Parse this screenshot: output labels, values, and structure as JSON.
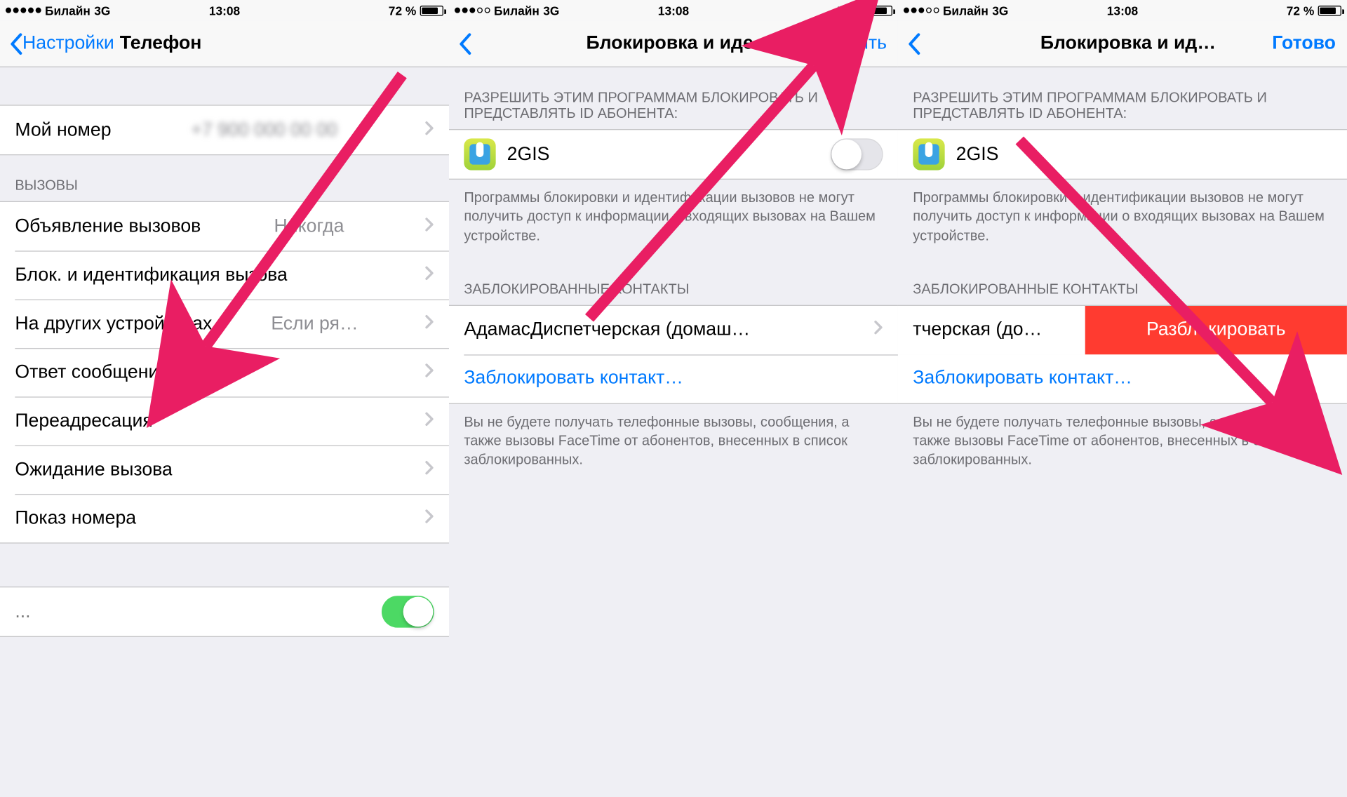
{
  "status": {
    "carrier": "Билайн",
    "net": "3G",
    "time": "13:08",
    "batteryText": "72 %"
  },
  "p1": {
    "backLabel": "Настройки",
    "title": "Телефон",
    "rows": {
      "myNumber": "Мой номер",
      "callsHeader": "ВЫЗОВЫ",
      "announce": "Объявление вызовов",
      "announceVal": "Никогда",
      "blockId": "Блок. и идентификация вызова",
      "otherDev": "На других устройствах",
      "otherDevVal": "Если ря…",
      "respond": "Ответ сообщением",
      "forward": "Переадресация",
      "waiting": "Ожидание вызова",
      "callerId": "Показ номера"
    }
  },
  "p2": {
    "title": "Блокировка и иде…",
    "action": "Изменить",
    "sec1Header": "РАЗРЕШИТЬ ЭТИМ ПРОГРАММАМ БЛОКИРОВАТЬ И ПРЕДСТАВЛЯТЬ ID АБОНЕНТА:",
    "app": "2GIS",
    "sec1Footer": "Программы блокировки и идентификации вызовов не могут получить доступ к информации о входящих вызовах на Вашем устройстве.",
    "sec2Header": "ЗАБЛОКИРОВАННЫЕ КОНТАКТЫ",
    "contact": "АдамасДиспетчерская (домаш…",
    "addBlock": "Заблокировать контакт…",
    "sec2Footer": "Вы не будете получать телефонные вызовы, сообщения, а также вызовы FaceTime от абонентов, внесенных в список заблокированных."
  },
  "p3": {
    "title": "Блокировка и ид…",
    "action": "Готово",
    "contactSwiped": "тчерская (до…",
    "unblock": "Разблокировать"
  },
  "arrowColor": "#e91e63"
}
